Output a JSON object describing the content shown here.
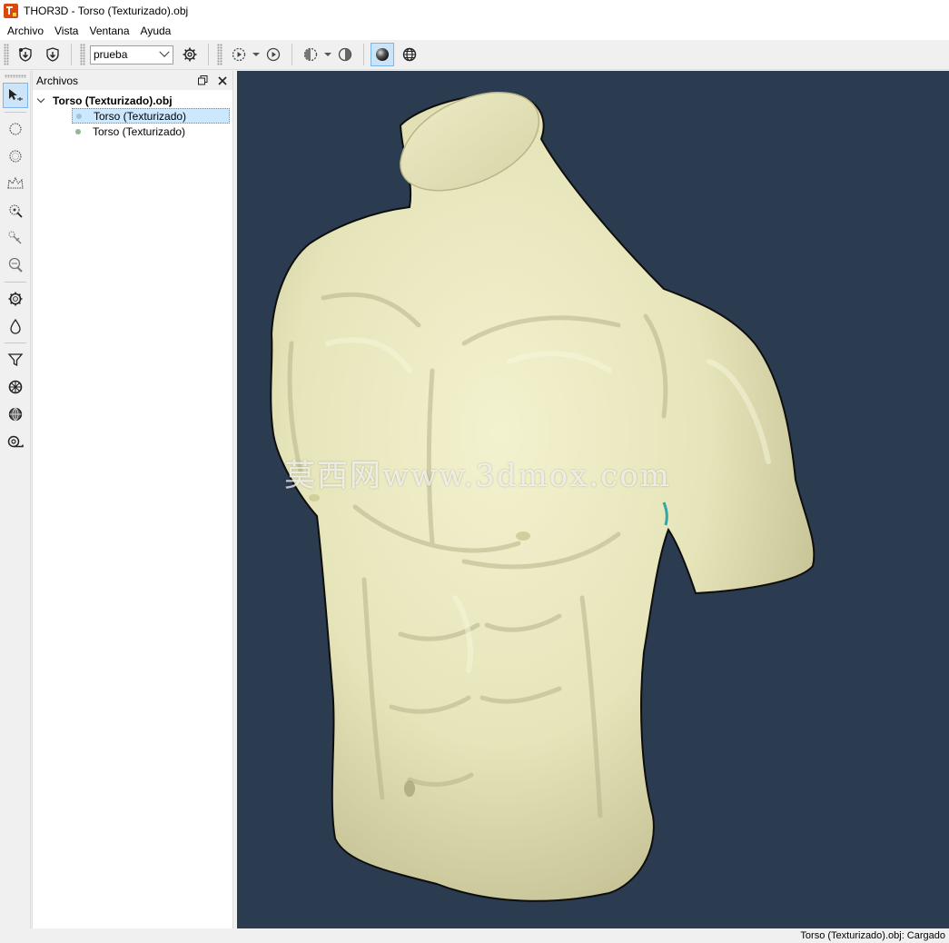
{
  "window": {
    "title": "THOR3D - Torso (Texturizado).obj"
  },
  "menu": {
    "items": [
      "Archivo",
      "Vista",
      "Ventana",
      "Ayuda"
    ]
  },
  "toolbar": {
    "profile_value": "prueba"
  },
  "files_panel": {
    "title": "Archivos",
    "root_label": "Torso (Texturizado).obj",
    "items": [
      {
        "label": "Torso (Texturizado)",
        "selected": true
      },
      {
        "label": "Torso (Texturizado)",
        "selected": false
      }
    ]
  },
  "viewport": {
    "background": "#2b3b50",
    "model_color": "#ecebc4",
    "watermark": "莫西网www.3dmox.com"
  },
  "status": {
    "text": "Torso (Texturizado).obj: Cargado"
  },
  "icons": {
    "toolbar": [
      "shield-down-icon",
      "shield-down-alt-icon",
      "gear-icon",
      "play-circle-dashed-icon",
      "play-circle-icon",
      "half-sphere-dashed-icon",
      "half-sphere-icon",
      "sphere-icon",
      "globe-icon"
    ],
    "left": [
      "select-arrow-icon",
      "circle-select-icon",
      "dashed-circle-select-icon",
      "crown-select-icon",
      "magic-select-icon",
      "scissors-icon",
      "lasso-icon",
      "gear-ring-icon",
      "drop-icon",
      "funnel-icon",
      "wheel-icon",
      "sphere-grid-icon",
      "tape-measure-icon"
    ]
  }
}
